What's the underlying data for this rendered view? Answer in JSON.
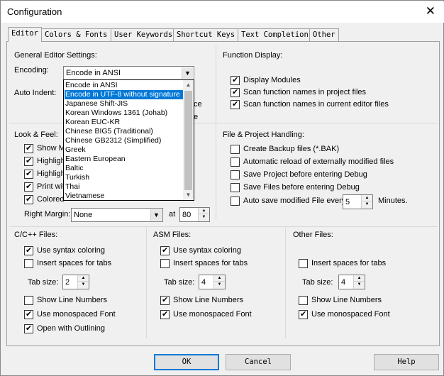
{
  "window": {
    "title": "Configuration",
    "close": "✕"
  },
  "tabs": [
    "Editor",
    "Colors & Fonts",
    "User Keywords",
    "Shortcut Keys",
    "Text Completion",
    "Other"
  ],
  "general": {
    "heading": "General Editor Settings:",
    "encoding_label": "Encoding:",
    "encoding_value": "Encode in ANSI",
    "auto_indent_label": "Auto Indent:",
    "hidden_right_1": "ce",
    "hidden_right_2": "e"
  },
  "encoding_options": [
    "Encode in ANSI",
    "Encode in UTF-8 without signature",
    "Japanese Shift-JIS",
    "Korean Windows 1361 (Johab)",
    "Korean EUC-KR",
    "Chinese BIG5 (Traditional)",
    "Chinese GB2312 (Simplified)",
    "Greek",
    "Eastern European",
    "Baltic",
    "Turkish",
    "Thai",
    "Vietnamese"
  ],
  "look_feel": {
    "heading": "Look & Feel:",
    "items": [
      {
        "label": "Show M",
        "checked": true
      },
      {
        "label": "Highligh",
        "checked": true
      },
      {
        "label": "Highligh",
        "checked": true
      },
      {
        "label": "Print wit",
        "checked": true
      },
      {
        "label": "Colored",
        "checked": true
      }
    ],
    "right_margin_label": "Right Margin:",
    "right_margin_value": "None",
    "at_label": "at",
    "at_value": "80"
  },
  "function_display": {
    "heading": "Function Display:",
    "items": [
      {
        "label": "Display Modules",
        "checked": true
      },
      {
        "label": "Scan function names in project files",
        "checked": true
      },
      {
        "label": "Scan function names in current editor files",
        "checked": true
      }
    ]
  },
  "file_project": {
    "heading": "File & Project Handling:",
    "items": [
      {
        "label": "Create Backup files (*.BAK)",
        "checked": false
      },
      {
        "label": "Automatic reload of externally modified files",
        "checked": false
      },
      {
        "label": "Save Project before entering Debug",
        "checked": false
      },
      {
        "label": "Save Files before entering Debug",
        "checked": false
      }
    ],
    "autosave_label": "Auto save modified File every",
    "autosave_value": "5",
    "autosave_unit": "Minutes.",
    "autosave_checked": false
  },
  "cpp_files": {
    "heading": "C/C++ Files:",
    "syntax": {
      "label": "Use syntax coloring",
      "checked": true
    },
    "spaces": {
      "label": "Insert spaces for tabs",
      "checked": false
    },
    "tab_size_label": "Tab size:",
    "tab_size_value": "2",
    "line_numbers": {
      "label": "Show Line Numbers",
      "checked": false
    },
    "monospaced": {
      "label": "Use monospaced Font",
      "checked": true
    },
    "outlining": {
      "label": "Open with Outlining",
      "checked": true
    }
  },
  "asm_files": {
    "heading": "ASM Files:",
    "syntax": {
      "label": "Use syntax coloring",
      "checked": true
    },
    "spaces": {
      "label": "Insert spaces for tabs",
      "checked": false
    },
    "tab_size_label": "Tab size:",
    "tab_size_value": "4",
    "line_numbers": {
      "label": "Show Line Numbers",
      "checked": true
    },
    "monospaced": {
      "label": "Use monospaced Font",
      "checked": true
    }
  },
  "other_files": {
    "heading": "Other Files:",
    "spaces": {
      "label": "Insert spaces for tabs",
      "checked": false
    },
    "tab_size_label": "Tab size:",
    "tab_size_value": "4",
    "line_numbers": {
      "label": "Show Line Numbers",
      "checked": false
    },
    "monospaced": {
      "label": "Use monospaced Font",
      "checked": true
    }
  },
  "buttons": {
    "ok": "OK",
    "cancel": "Cancel",
    "help": "Help"
  },
  "check_glyph": "✔"
}
